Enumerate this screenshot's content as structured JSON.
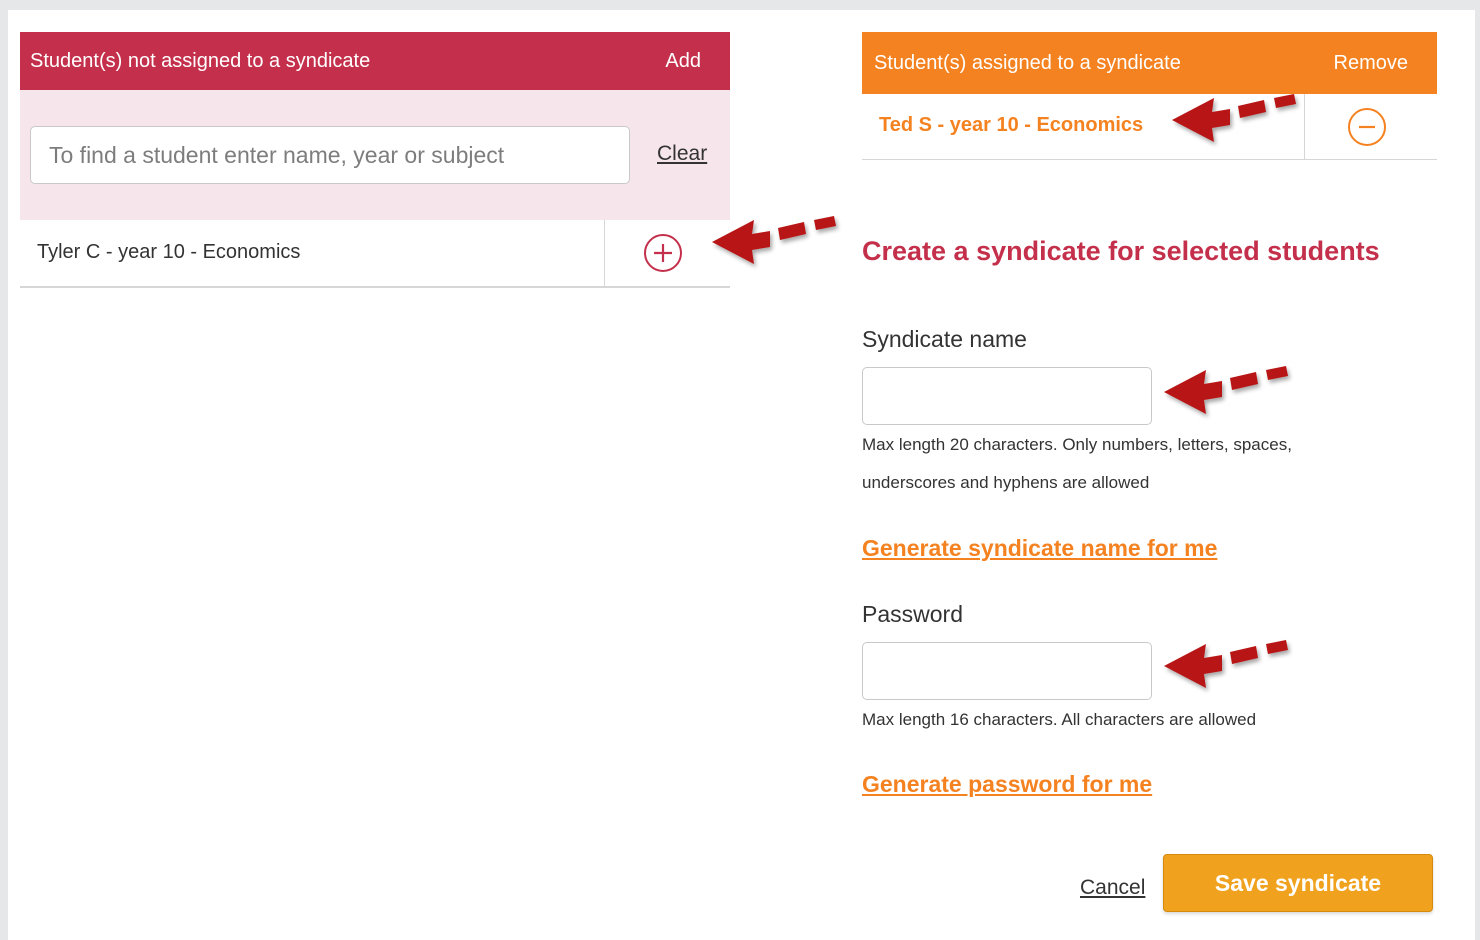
{
  "colors": {
    "crimson": "#c4304b",
    "orange": "#f58220",
    "save_button": "#f0a21e",
    "search_area_bg": "#f6e5ea",
    "annotation_arrow": "#b81414"
  },
  "left_panel": {
    "header_title": "Student(s) not assigned to a syndicate",
    "header_action": "Add",
    "search": {
      "placeholder": "To find a student enter name, year or subject",
      "value": ""
    },
    "clear_label": "Clear",
    "students": [
      {
        "label": "Tyler C - year 10 - Economics",
        "action_icon": "plus-circle-icon"
      }
    ]
  },
  "right_panel": {
    "header_title": "Student(s) assigned to a syndicate",
    "header_action": "Remove",
    "students": [
      {
        "label": "Ted S - year 10 - Economics",
        "action_icon": "minus-circle-icon"
      }
    ]
  },
  "form": {
    "title": "Create a syndicate for selected students",
    "syndicate_name": {
      "label": "Syndicate name",
      "value": "",
      "hint": "Max length 20 characters. Only numbers, letters, spaces, underscores and hyphens are allowed"
    },
    "generate_name_link": "Generate syndicate name for me",
    "password": {
      "label": "Password",
      "value": "",
      "hint": "Max length 16 characters. All characters are allowed"
    },
    "generate_password_link": "Generate password for me",
    "cancel_label": "Cancel",
    "save_label": "Save syndicate"
  },
  "annotations": [
    {
      "icon": "arrow-pointer-icon",
      "target": "remove-student-row"
    },
    {
      "icon": "arrow-pointer-icon",
      "target": "add-student-button"
    },
    {
      "icon": "arrow-pointer-icon",
      "target": "syndicate-name-input"
    },
    {
      "icon": "arrow-pointer-icon",
      "target": "password-input"
    }
  ]
}
